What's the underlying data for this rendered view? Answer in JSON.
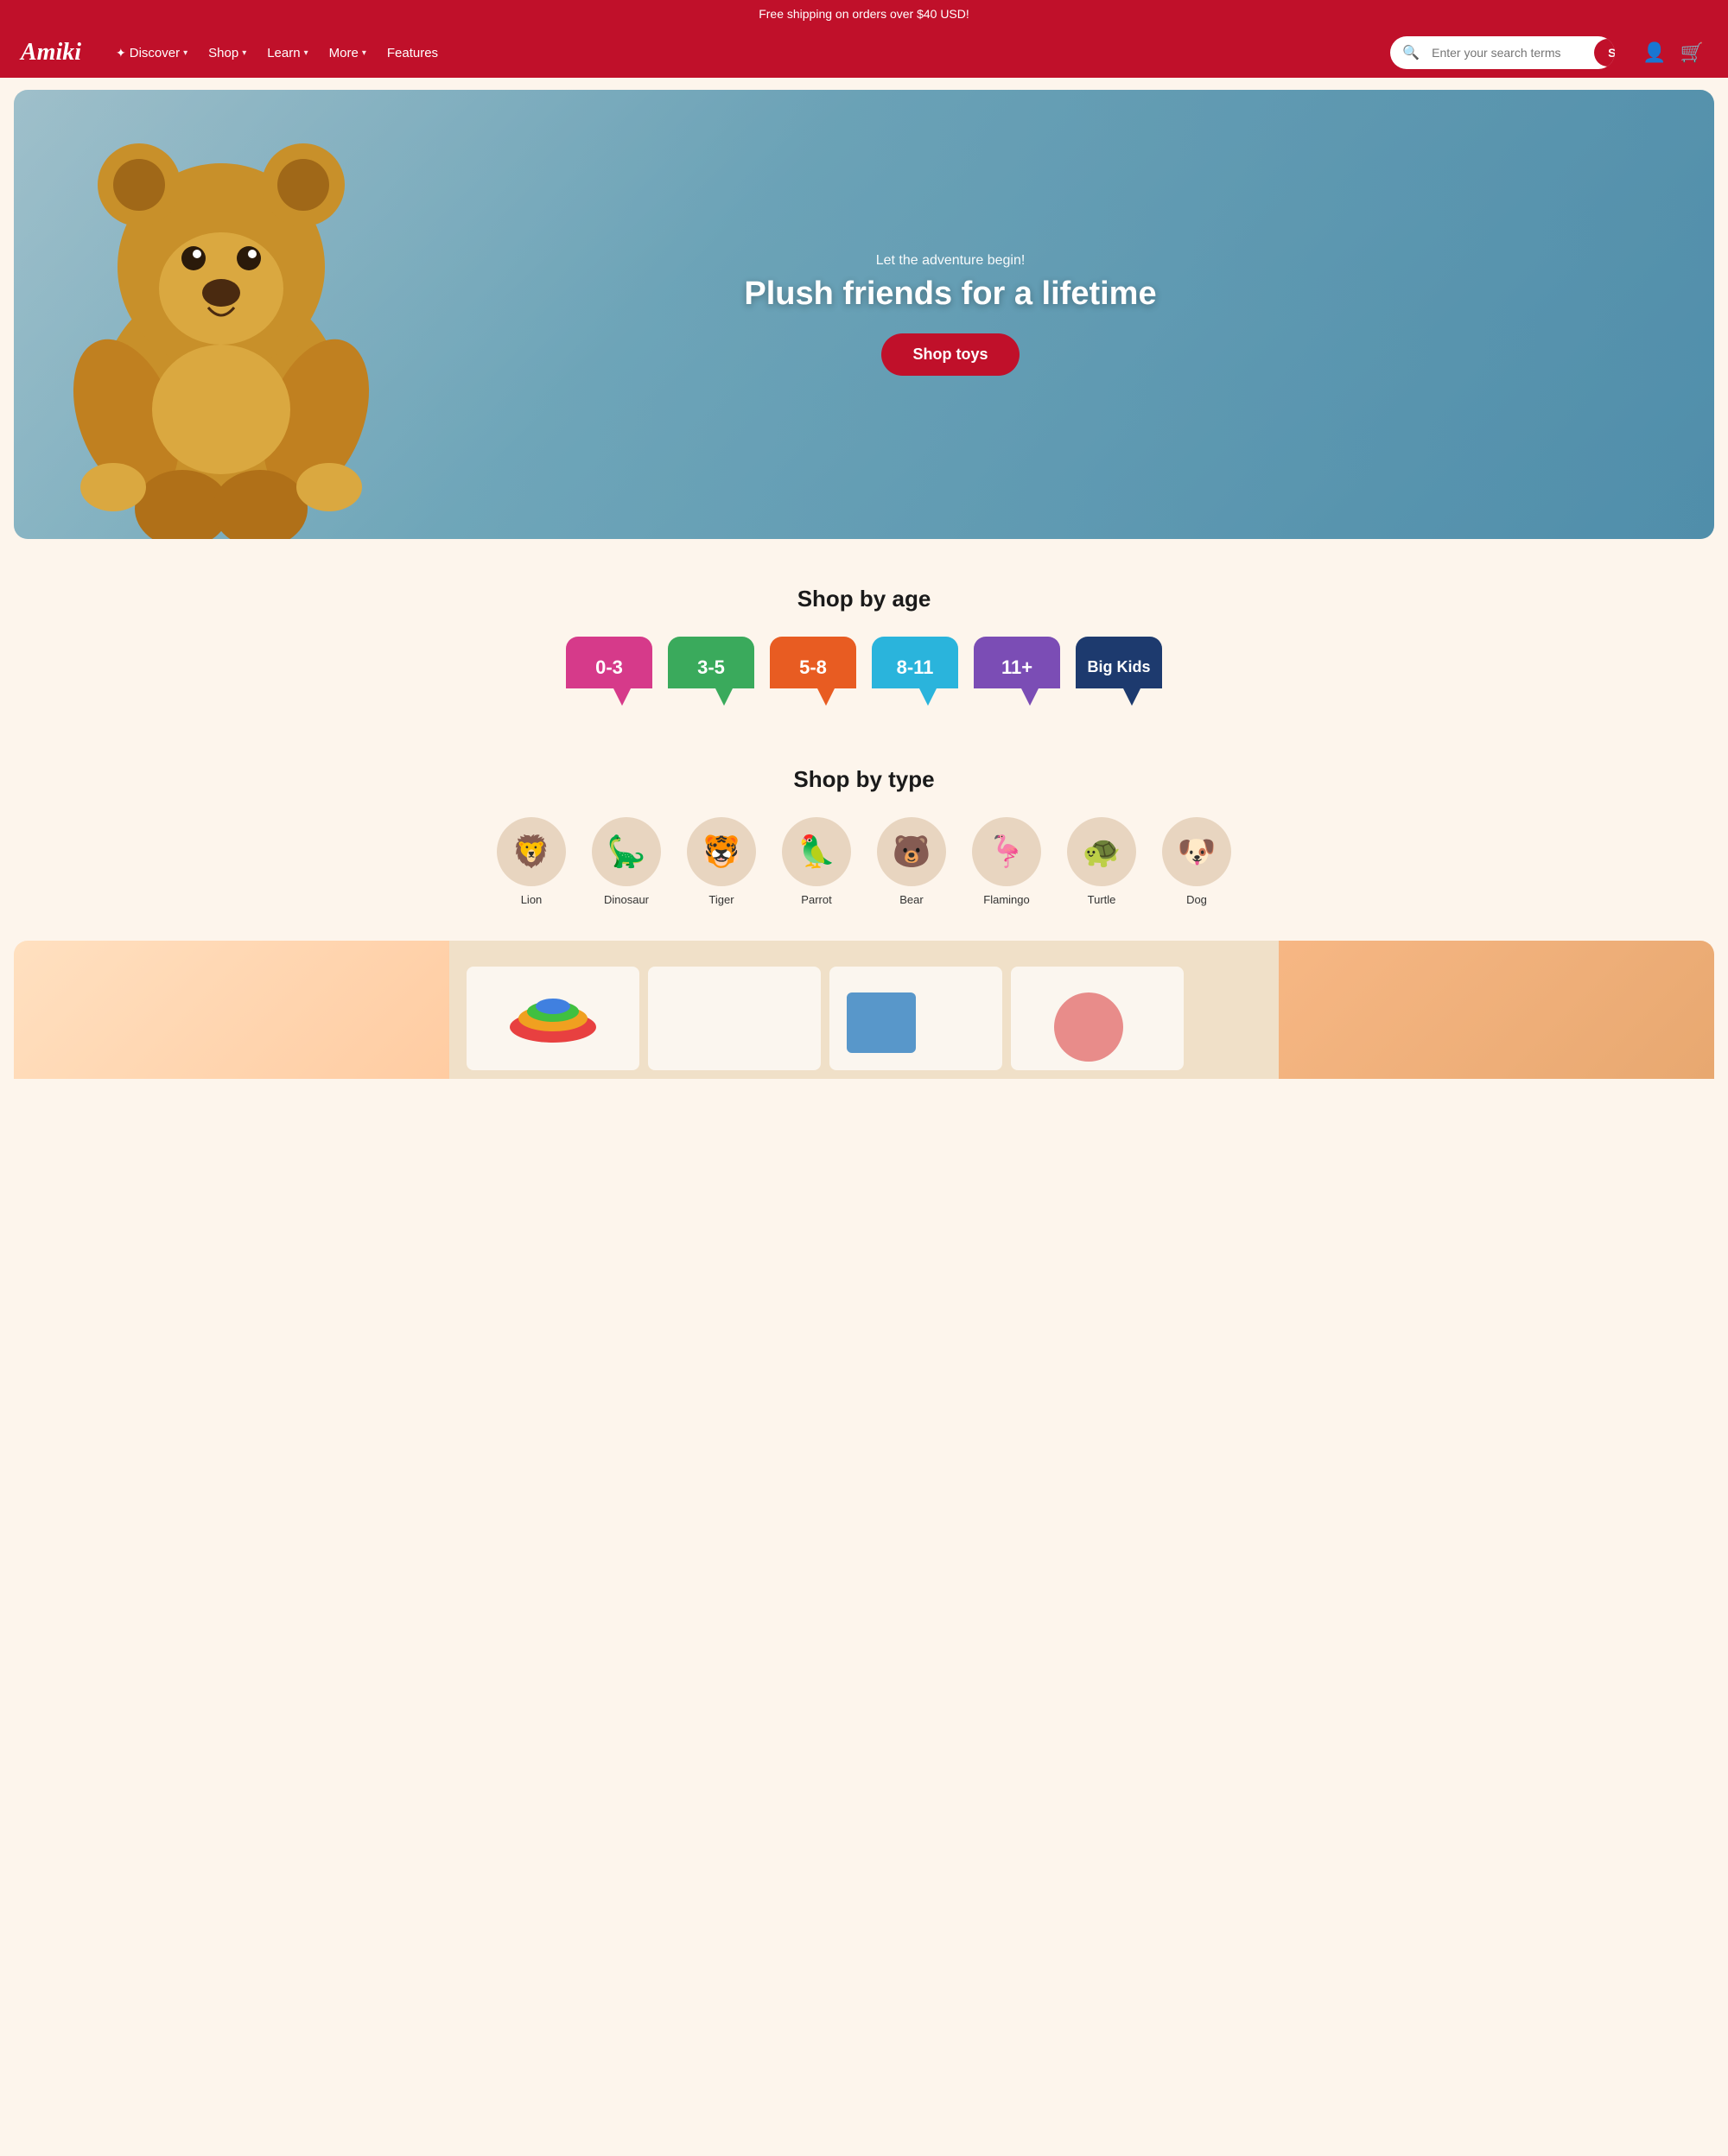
{
  "banner": {
    "text": "Free shipping on orders over $40 USD!"
  },
  "header": {
    "logo": "Amiki",
    "nav": [
      {
        "label": "Discover",
        "hasDropdown": true,
        "sparkle": true
      },
      {
        "label": "Shop",
        "hasDropdown": true
      },
      {
        "label": "Learn",
        "hasDropdown": true
      },
      {
        "label": "More",
        "hasDropdown": true
      },
      {
        "label": "Features",
        "hasDropdown": false
      }
    ],
    "search": {
      "placeholder": "Enter your search terms",
      "button_label": "Search"
    },
    "icons": [
      "account",
      "cart"
    ]
  },
  "hero": {
    "tagline": "Let the adventure begin!",
    "title": "Plush friends for a lifetime",
    "cta_label": "Shop toys"
  },
  "shop_by_age": {
    "title": "Shop by age",
    "badges": [
      {
        "label": "0-3",
        "color": "pink"
      },
      {
        "label": "3-5",
        "color": "green"
      },
      {
        "label": "5-8",
        "color": "orange"
      },
      {
        "label": "8-11",
        "color": "blue"
      },
      {
        "label": "11+",
        "color": "purple"
      },
      {
        "label": "Big Kids",
        "color": "dark-blue"
      }
    ]
  },
  "shop_by_type": {
    "title": "Shop by type",
    "items": [
      {
        "label": "Lion",
        "emoji": "🦁"
      },
      {
        "label": "Dinosaur",
        "emoji": "🦕"
      },
      {
        "label": "Tiger",
        "emoji": "🐯"
      },
      {
        "label": "Parrot",
        "emoji": "🦜"
      },
      {
        "label": "Bear",
        "emoji": "🐻"
      },
      {
        "label": "Flamingo",
        "emoji": "🦩"
      },
      {
        "label": "Turtle",
        "emoji": "🐢"
      },
      {
        "label": "Dog",
        "emoji": "🐶"
      }
    ]
  }
}
